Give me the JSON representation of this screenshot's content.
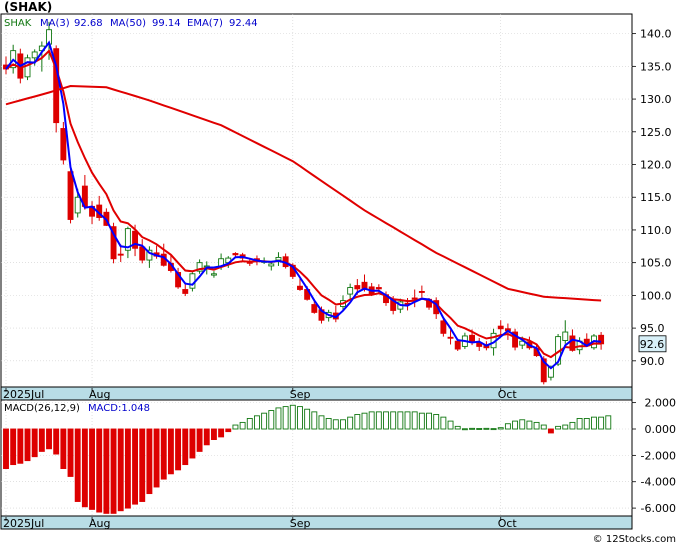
{
  "header": {
    "ticker": "(SHAK)"
  },
  "footer": {
    "copyright": "© 12Stocks.com"
  },
  "colors": {
    "up": "#117711",
    "down": "#dd0000",
    "ma3": "#0000ff",
    "ma50": "#e00000",
    "ema7": "#e00000",
    "axis_band": "#b8dde6",
    "price_label_bg": "#d8f0f8"
  },
  "chart_data": [
    {
      "type": "candlestick",
      "symbol": "SHAK",
      "legend": [
        {
          "text": "SHAK",
          "color": "#117711"
        },
        {
          "text": "MA(3)",
          "color": "#0000cc"
        },
        {
          "text": "92.68",
          "color": "#0000cc"
        },
        {
          "text": "MA(50)",
          "color": "#0000cc"
        },
        {
          "text": "99.14",
          "color": "#0000cc"
        },
        {
          "text": "EMA(7)",
          "color": "#0000cc"
        },
        {
          "text": "92.44",
          "color": "#0000cc"
        }
      ],
      "ylim": [
        86,
        143
      ],
      "yticks": [
        90,
        95,
        100,
        105,
        110,
        115,
        120,
        125,
        130,
        135,
        140
      ],
      "x_labels": [
        {
          "i": 0,
          "text": "2025Jul"
        },
        {
          "i": 12,
          "text": "Aug"
        },
        {
          "i": 40,
          "text": "Sep"
        },
        {
          "i": 69,
          "text": "Oct"
        }
      ],
      "last_price_label": "92.6",
      "candles": [
        [
          135.2,
          136.5,
          133.8,
          134.6
        ],
        [
          134.8,
          138.3,
          133.9,
          137.4
        ],
        [
          136.9,
          137.7,
          132.4,
          133.2
        ],
        [
          133.4,
          136.8,
          132.9,
          136.3
        ],
        [
          136.3,
          137.6,
          135.1,
          137.2
        ],
        [
          137.4,
          138.8,
          134.2,
          138.1
        ],
        [
          138.4,
          141.8,
          136.0,
          140.6
        ],
        [
          137.7,
          138.2,
          124.9,
          126.4
        ],
        [
          125.5,
          126.5,
          120.0,
          120.7
        ],
        [
          118.9,
          119.4,
          111.0,
          111.6
        ],
        [
          112.6,
          116.3,
          111.9,
          115.0
        ],
        [
          116.7,
          118.4,
          113.1,
          113.6
        ],
        [
          113.6,
          114.4,
          110.9,
          112.1
        ],
        [
          113.8,
          115.2,
          111.4,
          111.9
        ],
        [
          112.7,
          113.3,
          110.6,
          110.7
        ],
        [
          110.5,
          111.1,
          104.9,
          105.6
        ],
        [
          106.3,
          107.8,
          105.1,
          106.2
        ],
        [
          106.9,
          110.5,
          105.7,
          110.2
        ],
        [
          109.8,
          110.8,
          106.0,
          107.2
        ],
        [
          107.4,
          108.6,
          104.9,
          105.4
        ],
        [
          105.4,
          107.5,
          104.2,
          106.9
        ],
        [
          106.5,
          107.6,
          105.6,
          106.0
        ],
        [
          106.3,
          107.9,
          104.4,
          104.6
        ],
        [
          104.9,
          106.2,
          103.5,
          103.8
        ],
        [
          103.5,
          104.2,
          101.0,
          101.3
        ],
        [
          100.9,
          101.7,
          99.9,
          100.3
        ],
        [
          101.1,
          103.5,
          100.6,
          103.3
        ],
        [
          103.7,
          105.5,
          103.3,
          105.0
        ],
        [
          104.4,
          105.2,
          103.2,
          104.5
        ],
        [
          103.1,
          103.7,
          102.7,
          103.3
        ],
        [
          104.4,
          106.4,
          103.9,
          105.6
        ],
        [
          105.0,
          106.0,
          104.2,
          105.7
        ],
        [
          106.4,
          106.6,
          105.8,
          106.2
        ],
        [
          106.2,
          106.5,
          105.2,
          105.7
        ],
        [
          105.2,
          105.6,
          104.5,
          104.9
        ],
        [
          105.6,
          106.1,
          104.6,
          105.4
        ],
        [
          105.1,
          105.8,
          104.8,
          105.2
        ],
        [
          104.5,
          105.2,
          103.8,
          104.8
        ],
        [
          105.4,
          106.6,
          104.5,
          105.8
        ],
        [
          105.9,
          106.4,
          104.1,
          104.4
        ],
        [
          104.6,
          104.9,
          102.5,
          102.9
        ],
        [
          101.4,
          102.6,
          100.7,
          100.9
        ],
        [
          100.9,
          101.4,
          99.2,
          99.4
        ],
        [
          98.6,
          99.4,
          97.2,
          97.4
        ],
        [
          97.8,
          98.3,
          95.7,
          96.2
        ],
        [
          96.6,
          97.8,
          96.0,
          97.4
        ],
        [
          97.3,
          98.4,
          95.9,
          96.4
        ],
        [
          98.3,
          100.0,
          97.6,
          99.2
        ],
        [
          100.2,
          101.8,
          99.2,
          101.2
        ],
        [
          101.5,
          102.5,
          100.1,
          101.0
        ],
        [
          102.0,
          103.2,
          100.6,
          100.9
        ],
        [
          101.3,
          101.9,
          99.9,
          100.2
        ],
        [
          101.2,
          101.7,
          100.4,
          101.0
        ],
        [
          100.1,
          100.6,
          98.4,
          98.9
        ],
        [
          99.3,
          99.9,
          97.1,
          97.7
        ],
        [
          97.9,
          99.5,
          97.3,
          99.0
        ],
        [
          98.8,
          99.6,
          97.7,
          98.6
        ],
        [
          99.6,
          100.9,
          98.2,
          99.4
        ],
        [
          100.6,
          101.5,
          99.7,
          100.5
        ],
        [
          99.4,
          99.6,
          97.8,
          98.2
        ],
        [
          99.2,
          99.7,
          96.4,
          97.2
        ],
        [
          96.1,
          96.4,
          93.7,
          94.2
        ],
        [
          93.6,
          94.7,
          92.5,
          93.5
        ],
        [
          93.0,
          93.4,
          91.5,
          91.8
        ],
        [
          92.2,
          94.3,
          91.8,
          93.8
        ],
        [
          93.9,
          94.8,
          92.4,
          92.8
        ],
        [
          92.8,
          93.5,
          91.5,
          92.2
        ],
        [
          92.4,
          93.0,
          91.6,
          92.0
        ],
        [
          92.0,
          94.9,
          90.8,
          94.2
        ],
        [
          95.3,
          96.2,
          93.8,
          94.9
        ],
        [
          94.9,
          95.7,
          93.2,
          94.6
        ],
        [
          94.4,
          94.9,
          91.6,
          92.1
        ],
        [
          92.4,
          93.7,
          91.8,
          93.0
        ],
        [
          92.9,
          93.7,
          91.7,
          92.0
        ],
        [
          91.9,
          92.4,
          90.6,
          90.8
        ],
        [
          90.3,
          90.7,
          86.4,
          86.8
        ],
        [
          87.5,
          89.3,
          87.0,
          89.0
        ],
        [
          89.5,
          94.1,
          89.2,
          93.7
        ],
        [
          93.1,
          96.2,
          92.6,
          94.4
        ],
        [
          93.8,
          94.8,
          91.4,
          91.6
        ],
        [
          91.7,
          93.6,
          91.0,
          93.0
        ],
        [
          93.3,
          94.2,
          92.2,
          92.3
        ],
        [
          92.0,
          94.1,
          91.7,
          93.8
        ],
        [
          93.9,
          94.4,
          91.7,
          92.6
        ]
      ]
    },
    {
      "type": "bar",
      "label": "MACD(26,12,9)",
      "value_label": "MACD:1.048",
      "ylim": [
        -6.6,
        2.2
      ],
      "yticks": [
        2.0,
        0.0,
        -2.0,
        -4.0,
        -6.0
      ],
      "tick_labels": [
        "2.000",
        "0.000",
        "-2.000",
        "-4.000",
        "-6.000"
      ],
      "x_labels": [
        {
          "i": 0,
          "text": "2025Jul"
        },
        {
          "i": 12,
          "text": "Aug"
        },
        {
          "i": 40,
          "text": "Sep"
        },
        {
          "i": 69,
          "text": "Oct"
        }
      ],
      "values": [
        -3.0,
        -2.7,
        -2.6,
        -2.4,
        -2.1,
        -1.7,
        -1.5,
        -1.9,
        -3.0,
        -3.6,
        -5.5,
        -5.9,
        -6.1,
        -6.3,
        -6.4,
        -6.4,
        -6.2,
        -6.0,
        -5.7,
        -5.5,
        -4.9,
        -4.4,
        -3.8,
        -3.4,
        -3.1,
        -2.7,
        -2.2,
        -1.7,
        -1.2,
        -0.8,
        -0.6,
        -0.2,
        0.3,
        0.5,
        0.8,
        1.0,
        1.2,
        1.4,
        1.6,
        1.7,
        1.8,
        1.7,
        1.5,
        1.3,
        1.0,
        0.8,
        0.7,
        0.7,
        0.9,
        1.1,
        1.2,
        1.3,
        1.3,
        1.3,
        1.3,
        1.3,
        1.3,
        1.3,
        1.2,
        1.2,
        1.1,
        0.9,
        0.6,
        0.2,
        0.02,
        0.05,
        0.04,
        0.05,
        0.03,
        0.1,
        0.4,
        0.6,
        0.7,
        0.6,
        0.5,
        0.3,
        -0.3,
        0.2,
        0.3,
        0.5,
        0.8,
        0.8,
        0.9,
        0.9,
        1.0
      ]
    }
  ]
}
